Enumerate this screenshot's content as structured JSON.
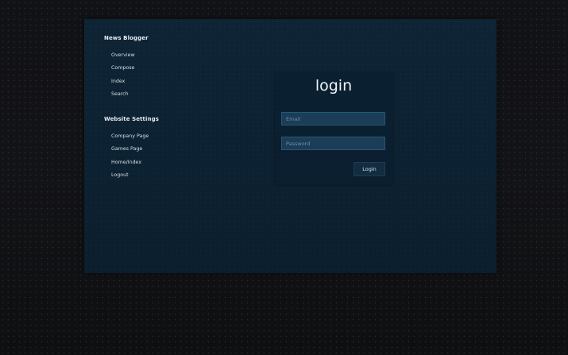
{
  "sidebar": {
    "sections": [
      {
        "title": "News Blogger",
        "items": [
          "Overview",
          "Compose",
          "Index",
          "Search"
        ]
      },
      {
        "title": "Website Settings",
        "items": [
          "Company Page",
          "Games Page",
          "Home/Index",
          "Logout"
        ]
      }
    ]
  },
  "login": {
    "title": "login",
    "email_placeholder": "Email",
    "password_placeholder": "Password",
    "button_label": "Login"
  },
  "colors": {
    "page_background": "#0f1012",
    "panel_background": "#0d2233",
    "input_background": "#1b3d58",
    "button_background": "#122c40",
    "text": "#e6edf3"
  }
}
